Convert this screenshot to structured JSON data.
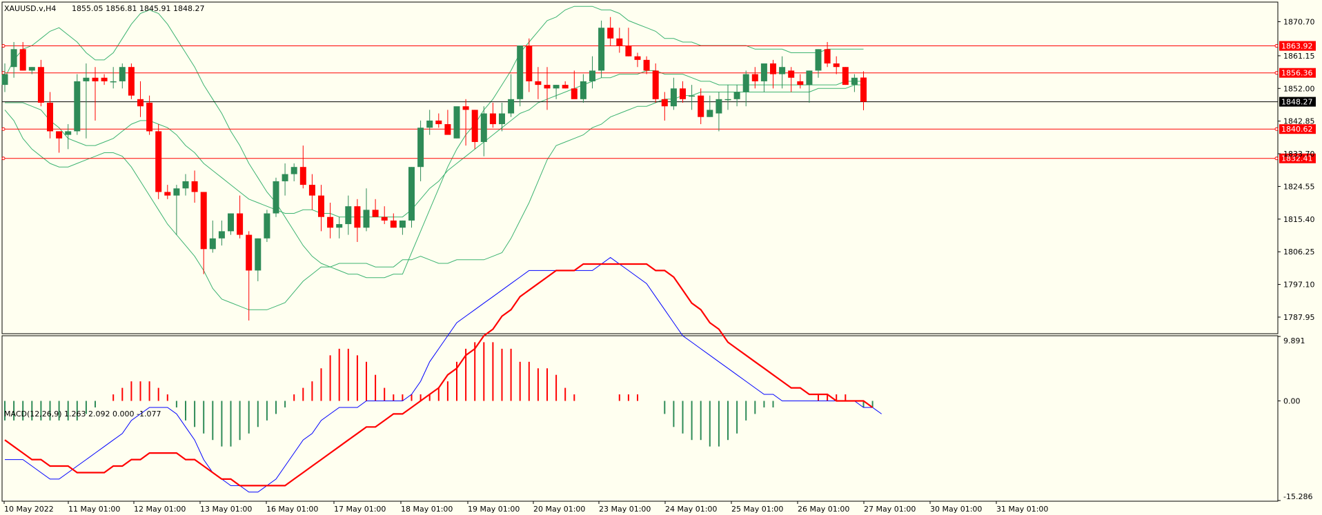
{
  "header": {
    "symbol": "XAUUSD.v,H4",
    "ohlc": "1855.05 1856.81 1845.91 1848.27"
  },
  "macd_header": "MACD(12,26,9) 1.263 2.092 0.000 -1.077",
  "colors": {
    "background": "#fffff0",
    "bull": "#2e8b57",
    "bear": "#ff0000",
    "bands": "#3cb371",
    "level": "#ff0000",
    "macd_line": "#0000ff",
    "signal_line": "#ff0000"
  },
  "chart_data": [
    {
      "type": "candlestick",
      "title": "XAUUSD.v,H4",
      "ylim": [
        1783.5,
        1876.0
      ],
      "y_ticks": [
        "1870.70",
        "1861.15",
        "1852.00",
        "1842.85",
        "1833.70",
        "1824.55",
        "1815.40",
        "1806.25",
        "1797.10",
        "1787.95"
      ],
      "current_price": "1848.27",
      "levels": [
        "1863.92",
        "1856.36",
        "1840.62",
        "1832.41"
      ],
      "x_labels": [
        "10 May 2022",
        "11 May 01:00",
        "12 May 01:00",
        "13 May 01:00",
        "16 May 01:00",
        "17 May 01:00",
        "18 May 01:00",
        "19 May 01:00",
        "20 May 01:00",
        "23 May 01:00",
        "24 May 01:00",
        "25 May 01:00",
        "26 May 01:00",
        "27 May 01:00",
        "30 May 01:00",
        "31 May 01:00"
      ],
      "candles": [
        [
          1853,
          1859,
          1851,
          1856
        ],
        [
          1858,
          1865,
          1855,
          1863
        ],
        [
          1863,
          1865,
          1857,
          1857
        ],
        [
          1857,
          1858,
          1856,
          1858
        ],
        [
          1858,
          1860,
          1847,
          1848
        ],
        [
          1848,
          1851,
          1838,
          1840
        ],
        [
          1840,
          1840,
          1834,
          1838
        ],
        [
          1839,
          1842,
          1835,
          1840
        ],
        [
          1840,
          1856,
          1839,
          1854
        ],
        [
          1854,
          1859,
          1838,
          1855
        ],
        [
          1855,
          1858,
          1843,
          1854
        ],
        [
          1855,
          1856,
          1853,
          1854
        ],
        [
          1854,
          1858,
          1852,
          1854
        ],
        [
          1854,
          1859,
          1852,
          1858
        ],
        [
          1858,
          1859,
          1849,
          1850
        ],
        [
          1849,
          1854,
          1844,
          1847
        ],
        [
          1848,
          1850,
          1839,
          1840
        ],
        [
          1840,
          1842,
          1821,
          1823
        ],
        [
          1823,
          1825,
          1821,
          1822
        ],
        [
          1822,
          1825,
          1811,
          1824
        ],
        [
          1824,
          1828,
          1822,
          1826
        ],
        [
          1826,
          1829,
          1820,
          1823
        ],
        [
          1823,
          1823,
          1800,
          1807
        ],
        [
          1807,
          1815,
          1806,
          1810
        ],
        [
          1810,
          1815,
          1808,
          1812
        ],
        [
          1812,
          1817,
          1811,
          1817
        ],
        [
          1817,
          1822,
          1810,
          1811
        ],
        [
          1811,
          1812,
          1787,
          1801
        ],
        [
          1801,
          1810,
          1798,
          1810
        ],
        [
          1810,
          1818,
          1809,
          1817
        ],
        [
          1817,
          1827,
          1816,
          1826
        ],
        [
          1826,
          1831,
          1822,
          1828
        ],
        [
          1828,
          1831,
          1826,
          1830
        ],
        [
          1830,
          1836,
          1824,
          1825
        ],
        [
          1825,
          1828,
          1818,
          1822
        ],
        [
          1822,
          1825,
          1812,
          1816
        ],
        [
          1816,
          1820,
          1810,
          1813
        ],
        [
          1813,
          1816,
          1810,
          1814
        ],
        [
          1814,
          1822,
          1811,
          1819
        ],
        [
          1819,
          1821,
          1809,
          1813
        ],
        [
          1813,
          1824,
          1812,
          1818
        ],
        [
          1818,
          1821,
          1816,
          1816
        ],
        [
          1816,
          1819,
          1814,
          1815
        ],
        [
          1815,
          1817,
          1813,
          1813
        ],
        [
          1813,
          1815,
          1811,
          1815
        ],
        [
          1815,
          1830,
          1813,
          1830
        ],
        [
          1830,
          1843,
          1826,
          1841
        ],
        [
          1841,
          1846,
          1839,
          1843
        ],
        [
          1843,
          1845,
          1841,
          1842
        ],
        [
          1842,
          1846,
          1840,
          1839
        ],
        [
          1838,
          1844,
          1838,
          1847
        ],
        [
          1847,
          1849,
          1836,
          1846
        ],
        [
          1846,
          1846,
          1835,
          1837
        ],
        [
          1837,
          1847,
          1833,
          1845
        ],
        [
          1845,
          1848,
          1841,
          1842
        ],
        [
          1842,
          1848,
          1840,
          1845
        ],
        [
          1845,
          1856,
          1844,
          1849
        ],
        [
          1849,
          1863,
          1847,
          1864
        ],
        [
          1864,
          1866,
          1851,
          1854
        ],
        [
          1854,
          1858,
          1849,
          1853
        ],
        [
          1853,
          1858,
          1846,
          1852
        ],
        [
          1852,
          1853,
          1849,
          1853
        ],
        [
          1853,
          1854,
          1852,
          1852
        ],
        [
          1852,
          1857,
          1850,
          1849
        ],
        [
          1849,
          1856,
          1848,
          1854
        ],
        [
          1854,
          1861,
          1852,
          1857
        ],
        [
          1857,
          1871,
          1855,
          1869
        ],
        [
          1869,
          1872,
          1864,
          1866
        ],
        [
          1866,
          1869,
          1862,
          1864
        ],
        [
          1864,
          1869,
          1861,
          1861
        ],
        [
          1861,
          1862,
          1858,
          1860
        ],
        [
          1860,
          1861,
          1856,
          1857
        ],
        [
          1857,
          1859,
          1848,
          1849
        ],
        [
          1849,
          1851,
          1843,
          1847
        ],
        [
          1847,
          1855,
          1846,
          1852
        ],
        [
          1852,
          1854,
          1848,
          1849
        ],
        [
          1850,
          1853,
          1846,
          1850
        ],
        [
          1850,
          1852,
          1842,
          1844
        ],
        [
          1844,
          1850,
          1844,
          1846
        ],
        [
          1845,
          1851,
          1840,
          1849
        ],
        [
          1849,
          1853,
          1846,
          1849
        ],
        [
          1849,
          1853,
          1847,
          1851
        ],
        [
          1851,
          1857,
          1847,
          1856
        ],
        [
          1856,
          1858,
          1852,
          1854
        ],
        [
          1854,
          1858,
          1851,
          1859
        ],
        [
          1859,
          1860,
          1852,
          1856
        ],
        [
          1856,
          1861,
          1852,
          1858
        ],
        [
          1857,
          1858,
          1851,
          1855
        ],
        [
          1854,
          1856,
          1852,
          1853
        ],
        [
          1853,
          1857,
          1848,
          1857
        ],
        [
          1857,
          1863,
          1855,
          1863
        ],
        [
          1863,
          1865,
          1858,
          1859
        ],
        [
          1859,
          1861,
          1856,
          1858
        ],
        [
          1858,
          1858,
          1853,
          1853
        ],
        [
          1853,
          1856,
          1851,
          1855
        ],
        [
          1855.05,
          1856.81,
          1845.91,
          1848.27
        ]
      ],
      "bollinger": {
        "upper": [
          1855,
          1860,
          1863,
          1864,
          1866,
          1868,
          1869,
          1867,
          1865,
          1862,
          1860,
          1860,
          1862,
          1866,
          1870,
          1873,
          1874,
          1873,
          1870,
          1866,
          1862,
          1858,
          1853,
          1849,
          1845,
          1840,
          1836,
          1831,
          1827,
          1823,
          1820,
          1816,
          1812,
          1808,
          1805,
          1803,
          1802,
          1801,
          1800,
          1800,
          1799,
          1799,
          1799,
          1800,
          1800,
          1806,
          1812,
          1818,
          1824,
          1830,
          1835,
          1839,
          1842,
          1846,
          1849,
          1853,
          1857,
          1862,
          1865,
          1868,
          1871,
          1872,
          1874,
          1875,
          1875,
          1875,
          1874,
          1874,
          1873,
          1871,
          1870,
          1869,
          1868,
          1866,
          1866,
          1865,
          1865,
          1864,
          1864,
          1864,
          1864,
          1864,
          1864,
          1863,
          1863,
          1863,
          1863,
          1862,
          1862,
          1862,
          1862,
          1863,
          1863,
          1863,
          1863,
          1863
        ],
        "middle": [
          1848,
          1848,
          1848,
          1847,
          1846,
          1843,
          1841,
          1838,
          1837,
          1836,
          1836,
          1837,
          1838,
          1840,
          1842,
          1843,
          1843,
          1842,
          1841,
          1839,
          1836,
          1834,
          1831,
          1829,
          1827,
          1825,
          1823,
          1821,
          1820,
          1819,
          1818,
          1817,
          1817,
          1818,
          1818,
          1817,
          1817,
          1816,
          1816,
          1816,
          1816,
          1816,
          1816,
          1816,
          1816,
          1818,
          1821,
          1824,
          1826,
          1829,
          1831,
          1833,
          1835,
          1837,
          1839,
          1841,
          1843,
          1845,
          1846,
          1848,
          1849,
          1850,
          1851,
          1852,
          1853,
          1854,
          1855,
          1855,
          1856,
          1856,
          1856,
          1857,
          1857,
          1856,
          1856,
          1856,
          1855,
          1854,
          1854,
          1853,
          1853,
          1853,
          1853,
          1853,
          1853,
          1853,
          1853,
          1853,
          1853,
          1853,
          1853,
          1853,
          1853,
          1854,
          1854,
          1854
        ],
        "lower": [
          1846,
          1843,
          1838,
          1835,
          1833,
          1831,
          1830,
          1830,
          1831,
          1832,
          1833,
          1834,
          1834,
          1833,
          1830,
          1826,
          1822,
          1818,
          1814,
          1811,
          1808,
          1805,
          1801,
          1796,
          1793,
          1792,
          1791,
          1790,
          1790,
          1790,
          1791,
          1792,
          1795,
          1798,
          1800,
          1802,
          1802,
          1803,
          1803,
          1803,
          1803,
          1802,
          1802,
          1802,
          1804,
          1804,
          1805,
          1804,
          1803,
          1803,
          1804,
          1804,
          1804,
          1804,
          1805,
          1806,
          1810,
          1815,
          1820,
          1826,
          1832,
          1836,
          1837,
          1838,
          1839,
          1841,
          1842,
          1844,
          1845,
          1846,
          1847,
          1847,
          1848,
          1849,
          1849,
          1850,
          1850,
          1851,
          1851,
          1851,
          1851,
          1851,
          1851,
          1851,
          1851,
          1851,
          1851,
          1851,
          1851,
          1851,
          1852,
          1852,
          1852,
          1852,
          1853,
          1853
        ]
      }
    },
    {
      "type": "macd",
      "title": "MACD(12,26,9)",
      "ylim": [
        -15.286,
        9.891
      ],
      "y_ticks": [
        "9.891",
        "0.00",
        "-15.286"
      ],
      "histogram": [
        -3,
        -3,
        -3,
        -3,
        -3,
        -3,
        -3,
        -3,
        -3,
        -2,
        -1,
        0,
        1,
        2,
        3,
        3,
        3,
        2,
        1,
        -1,
        -3,
        -4,
        -5,
        -6,
        -7,
        -7,
        -6,
        -5,
        -4,
        -3,
        -2,
        -1,
        1,
        2,
        3,
        5,
        7,
        8,
        8,
        7,
        6,
        4,
        2,
        1,
        1,
        1,
        1,
        1,
        2,
        3,
        6,
        8,
        9,
        9,
        9,
        8,
        8,
        6,
        6,
        5,
        5,
        4,
        2,
        1,
        0,
        0,
        0,
        0,
        1,
        1,
        1,
        0,
        0,
        -2,
        -4,
        -5,
        -6,
        -6,
        -7,
        -7,
        -6,
        -5,
        -3,
        -2,
        -1,
        -1,
        0,
        0,
        0,
        0,
        1,
        1,
        1,
        1,
        0,
        -1,
        -1
      ],
      "macd": [
        -9,
        -9,
        -9,
        -10,
        -11,
        -12,
        -12,
        -11,
        -10,
        -9,
        -8,
        -7,
        -6,
        -5,
        -3,
        -2,
        -1,
        -1,
        -1,
        -2,
        -4,
        -6,
        -9,
        -11,
        -12,
        -13,
        -13,
        -14,
        -14,
        -13,
        -12,
        -10,
        -8,
        -6,
        -5,
        -3,
        -2,
        -1,
        -1,
        -1,
        0,
        0,
        0,
        0,
        0,
        1,
        3,
        6,
        8,
        10,
        12,
        13,
        14,
        15,
        16,
        17,
        18,
        19,
        20,
        20,
        20,
        20,
        20,
        20,
        20,
        20,
        21,
        22,
        21,
        20,
        19,
        18,
        16,
        14,
        12,
        10,
        9,
        8,
        7,
        6,
        5,
        4,
        3,
        2,
        1,
        1,
        0,
        0,
        0,
        0,
        0,
        0,
        0,
        0,
        0,
        -1,
        -1,
        -2
      ],
      "signal": [
        -6,
        -7,
        -8,
        -9,
        -9,
        -10,
        -10,
        -10,
        -11,
        -11,
        -11,
        -11,
        -10,
        -10,
        -9,
        -9,
        -8,
        -8,
        -8,
        -8,
        -9,
        -9,
        -10,
        -11,
        -12,
        -12,
        -13,
        -13,
        -13,
        -13,
        -13,
        -13,
        -12,
        -11,
        -10,
        -9,
        -8,
        -7,
        -6,
        -5,
        -4,
        -4,
        -3,
        -2,
        -2,
        -1,
        0,
        1,
        2,
        4,
        5,
        7,
        8,
        10,
        11,
        13,
        14,
        16,
        17,
        18,
        19,
        20,
        20,
        20,
        21,
        21,
        21,
        21,
        21,
        21,
        21,
        21,
        20,
        20,
        19,
        17,
        15,
        14,
        12,
        11,
        9,
        8,
        7,
        6,
        5,
        4,
        3,
        2,
        2,
        1,
        1,
        1,
        0,
        0,
        0,
        0,
        -1
      ]
    }
  ]
}
